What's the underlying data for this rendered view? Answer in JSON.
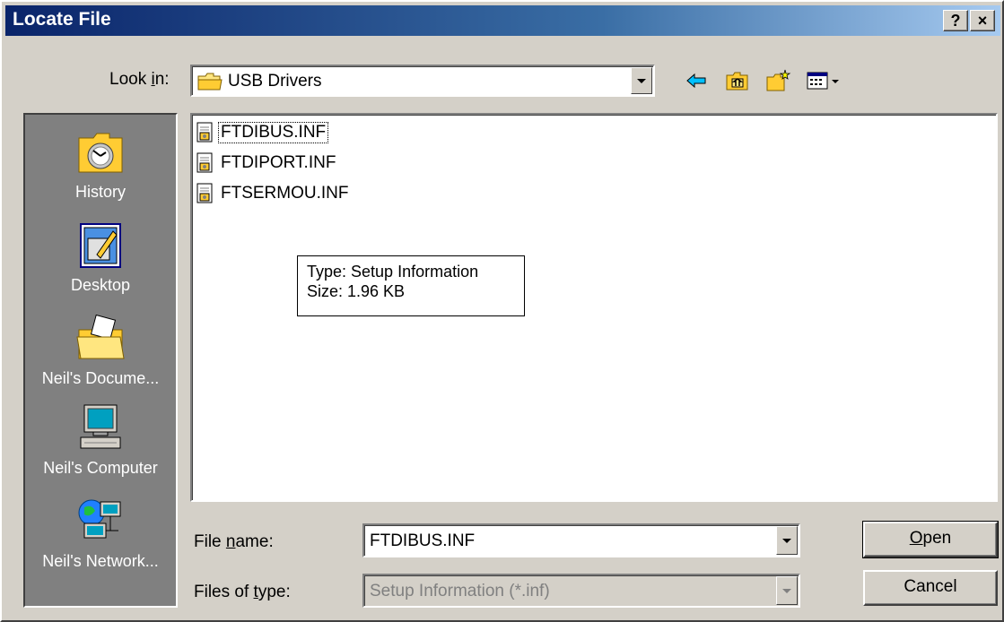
{
  "dialog": {
    "title": "Locate File",
    "help_button": "?",
    "close_button": "×"
  },
  "lookin": {
    "label_pre": "Look ",
    "label_accel": "i",
    "label_post": "n:",
    "value": "USB Drivers"
  },
  "toolbar": {
    "icons": [
      "back-arrow-icon",
      "up-one-level-icon",
      "create-new-folder-icon",
      "view-menu-icon"
    ]
  },
  "places": [
    {
      "label": "History",
      "icon": "history-icon"
    },
    {
      "label": "Desktop",
      "icon": "desktop-icon"
    },
    {
      "label": "Neil's Docume...",
      "icon": "my-documents-icon"
    },
    {
      "label": "Neil's Computer",
      "icon": "my-computer-icon"
    },
    {
      "label": "Neil's Network...",
      "icon": "network-places-icon"
    }
  ],
  "files": [
    {
      "name": "FTDIBUS.INF",
      "icon": "setup-information-file-icon"
    },
    {
      "name": "FTDIPORT.INF",
      "icon": "setup-information-file-icon"
    },
    {
      "name": "FTSERMOU.INF",
      "icon": "setup-information-file-icon"
    }
  ],
  "tooltip": {
    "line1": "Type: Setup Information",
    "line2": "Size: 1.96 KB"
  },
  "filename": {
    "label_pre": "File ",
    "label_accel": "n",
    "label_post": "ame:",
    "value": "FTDIBUS.INF"
  },
  "filetype": {
    "label_pre": "Files of ",
    "label_accel": "t",
    "label_post": "ype:",
    "value": "Setup Information (*.inf)"
  },
  "buttons": {
    "open_accel": "O",
    "open_rest": "pen",
    "cancel": "Cancel"
  },
  "colors": {
    "title_bar": "#0a246a",
    "face": "#d4d0c8",
    "places_bar": "#808080"
  }
}
